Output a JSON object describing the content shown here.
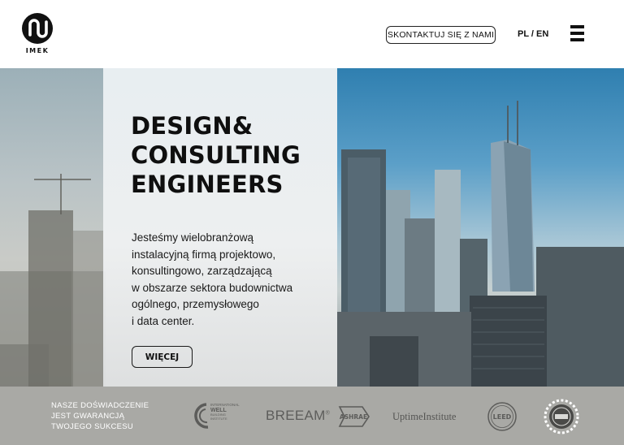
{
  "header": {
    "logo_text": "IMEK",
    "contact_label": "SKONTAKTUJ SIĘ Z NAMI",
    "lang_label": "PL / EN"
  },
  "hero": {
    "headline": [
      "DESIGN&",
      "CONSULTING",
      "ENGINEERS"
    ],
    "description": [
      "Jesteśmy wielobranżową",
      "instalacyjną firmą projektowo,",
      "konsultingowo, zarządzającą",
      "w obszarze sektora budownictwa",
      "ogólnego, przemysłowego",
      "i data center."
    ],
    "more_label": "WIĘCEJ"
  },
  "strip": {
    "tagline": [
      "NASZE DOŚWIADCZENIE",
      "JEST GWARANCJĄ",
      "TWOJEGO SUKCESU"
    ],
    "certifications": {
      "well": "INTERNATIONAL WELL BUILDING INSTITUTE",
      "breeam": "BREEAM",
      "breeam_mark": "®",
      "ashrae": "ASHRAE",
      "uptime": "UptimeInstitute",
      "leed": "LEED"
    }
  },
  "colors": {
    "strip_bg": "#a9a9a5",
    "text": "#111111",
    "sky": "#5b9fc8"
  },
  "icons": [
    "imek-logo-icon",
    "hamburger-menu-icon"
  ]
}
